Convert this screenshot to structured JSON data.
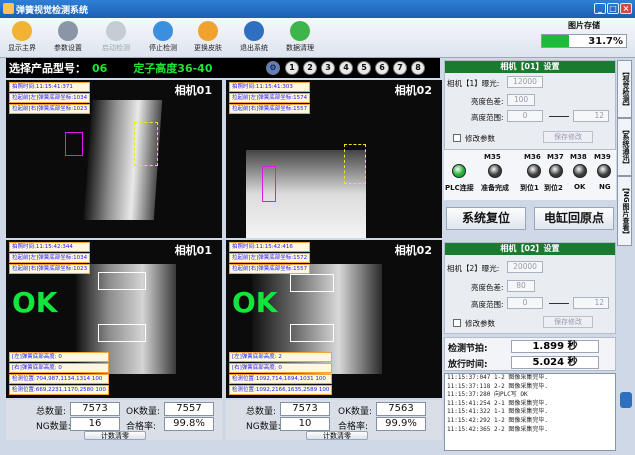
{
  "window": {
    "title": "弹簧视觉检测系统",
    "min_icon": "minimize-icon",
    "max_icon": "maximize-icon",
    "close_icon": "close-icon"
  },
  "toolbar": [
    {
      "label": "显示主界",
      "icon": "home-icon",
      "enabled": true
    },
    {
      "label": "参数设置",
      "icon": "tools-icon",
      "enabled": true
    },
    {
      "label": "启动检测",
      "icon": "play-icon",
      "enabled": false
    },
    {
      "label": "停止检测",
      "icon": "stop-icon",
      "enabled": true
    },
    {
      "label": "更换皮肤",
      "icon": "skin-icon",
      "enabled": true
    },
    {
      "label": "退出系统",
      "icon": "exit-icon",
      "enabled": true
    },
    {
      "label": "数据清理",
      "icon": "refresh-icon",
      "enabled": true
    }
  ],
  "storage": {
    "label": "图片存储",
    "percent_text": "31.7%",
    "percent": 31.7
  },
  "product": {
    "label": "选择产品型号：",
    "code": "06",
    "desc": "定子高度36-40",
    "icon": "settings-icon",
    "numbers": [
      "1",
      "2",
      "3",
      "4",
      "5",
      "6",
      "7",
      "8"
    ]
  },
  "cameras": [
    {
      "name": "相机01",
      "info": [
        "拍照时间:11:15:41:371",
        "拉起前[左]弹簧底部坐标:1034",
        "拉起前[右]弹簧底部坐标:1023"
      ],
      "ok": "",
      "binfo": []
    },
    {
      "name": "相机02",
      "info": [
        "拍照时间:11:15:41:303",
        "拉起前[左]弹簧底部坐标:1574",
        "拉起前[右]弹簧底部坐标:1557"
      ],
      "ok": "",
      "binfo": []
    },
    {
      "name": "相机01",
      "info": [
        "拍照时间:11:15:42:344",
        "拉起前[左]弹簧底部坐标:1034",
        "拉起前[右]弹簧底部坐标:1023"
      ],
      "ok": "OK",
      "binfo": [
        "[左]弹簧底部高度: 0",
        "[右]弹簧底部高度: 0",
        "检测位置:704,987,1134,1314 100",
        "检测位置:669,2231,1170,2580 100"
      ]
    },
    {
      "name": "相机02",
      "info": [
        "拍照时间:11:15:42:416",
        "拉起前[左]弹簧底部坐标:1572",
        "拉起前[右]弹簧底部坐标:1557"
      ],
      "ok": "OK",
      "binfo": [
        "[左]弹簧底部高度: 2",
        "[右]弹簧底部高度: 0",
        "检测位置:1092,714,1694,1031 100",
        "检测位置:1092,2166,1635,2589 100"
      ]
    }
  ],
  "stats": [
    {
      "total_label": "总数量:",
      "total": "7573",
      "ok_label": "OK数量:",
      "ok": "7557",
      "ng_label": "NG数量:",
      "ng": "16",
      "rate_label": "合格率:",
      "rate": "99.8%",
      "clear": "计数清零"
    },
    {
      "total_label": "总数量:",
      "total": "7573",
      "ok_label": "OK数量:",
      "ok": "7563",
      "ng_label": "NG数量:",
      "ng": "10",
      "rate_label": "合格率:",
      "rate": "99.9%",
      "clear": "计数清零"
    }
  ],
  "cam1_settings": {
    "header": "相机【01】设置",
    "exposure_label": "相机【1】曝光:",
    "exposure": "12000",
    "color_label": "亮度色差:",
    "color": "100",
    "range_label": "高度范围:",
    "range_min": "0",
    "range_max": "12",
    "modify_label": "修改参数",
    "save": "保存修改"
  },
  "cam2_settings": {
    "header": "相机【02】设置",
    "exposure_label": "相机【2】曝光:",
    "exposure": "20000",
    "color_label": "亮度色差:",
    "color": "80",
    "range_label": "高度范围:",
    "range_min": "0",
    "range_max": "12",
    "modify_label": "修改参数",
    "save": "保存修改"
  },
  "io": {
    "m_labels": [
      "M35",
      "M36",
      "M37",
      "M38",
      "M39"
    ],
    "lamp_labels": [
      "PLC连接",
      "准备完成",
      "到位1",
      "到位2",
      "OK",
      "NG"
    ],
    "lamp_colors": [
      "#1fae2c",
      "#3a3a3a",
      "#3a3a3a",
      "#3a3a3a",
      "#3a3a3a",
      "#3a3a3a"
    ]
  },
  "actions": {
    "reset": "系统复位",
    "cylinder": "电缸回原点"
  },
  "side_tabs": [
    "【视觉检测】",
    "【系统通讯】",
    "【NG图片查看】"
  ],
  "timing": {
    "cycle_label": "检测节拍:",
    "cycle": "1.899 秒",
    "release_label": "放行时间:",
    "release": "5.024 秒"
  },
  "log": [
    "11:15:37:047  1-2  图像采集完毕.",
    "11:15:37:118  2-2  图像采集完毕.",
    "11:15:37:280        向PLC写 OK",
    "11:15:41:254  2-1  图像采集完毕.",
    "11:15:41:322  1-1  图像采集完毕.",
    "11:15:42:292  1-2  图像采集完毕.",
    "11:15:42:365  2-2  图像采集完毕."
  ],
  "colors": {
    "accent": "#1a7a2e",
    "ok": "#12e63a",
    "title": "#1a5fb4"
  }
}
